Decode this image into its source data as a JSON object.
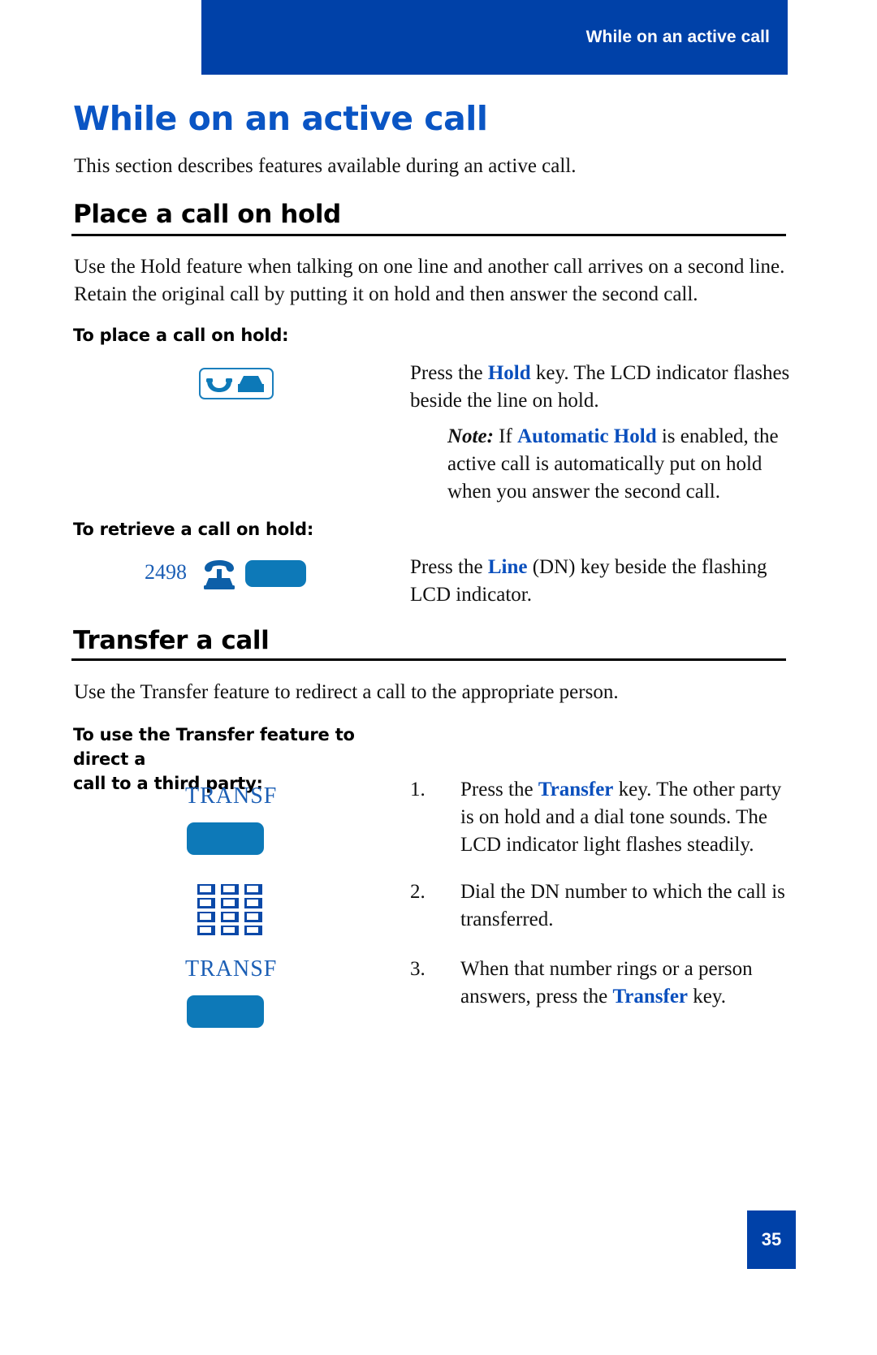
{
  "header": {
    "running_title": "While on an active call"
  },
  "page_title": "While on an active call",
  "intro": "This section describes features available during an active call.",
  "sections": [
    {
      "heading": "Place a call on hold",
      "body": "Use the Hold feature when talking on one line and another call arrives on a second line. Retain the original call by putting it on hold and then answer the second call.",
      "sub1_head": "To place a call on hold:",
      "sub1_icon": "hold-key-icon",
      "sub1_text_pre": "Press the ",
      "sub1_text_key": "Hold",
      "sub1_text_post": " key. The LCD indicator flashes beside the line on hold.",
      "note_label": "Note:",
      "note_pre": " If ",
      "note_key": "Automatic Hold",
      "note_post": " is enabled, the active call is automatically put on hold when you answer the second call.",
      "sub2_head": "To retrieve a call on hold:",
      "sub2_dn": "2498",
      "sub2_text_pre": "Press the ",
      "sub2_text_key": "Line",
      "sub2_text_post": " (DN) key beside the flashing LCD indicator."
    },
    {
      "heading": "Transfer a call",
      "body": "Use the Transfer feature to redirect a call to the appropriate person.",
      "sub1_head_line1": "To use the Transfer feature to direct a",
      "sub1_head_line2": "call to a third party:",
      "key_label_1": "TRANSF",
      "key_label_2": "TRANSF",
      "steps": [
        {
          "num": "1.",
          "pre": "Press the ",
          "key": "Transfer",
          "post": " key. The other party is on hold and a dial tone sounds. The LCD indicator light flashes steadily."
        },
        {
          "num": "2.",
          "pre": "Dial the DN number to which the call is transferred.",
          "key": "",
          "post": ""
        },
        {
          "num": "3.",
          "pre": "When that number rings or a person answers, press the ",
          "key": "Transfer",
          "post": " key."
        }
      ]
    }
  ],
  "footer": {
    "page_number": "35"
  },
  "colors": {
    "brand_blue": "#0041a8",
    "title_blue": "#0a55c4",
    "link_blue": "#0a4fbd",
    "key_blue": "#0d79b8",
    "keypad_blue": "#0b49a8",
    "serif_blue": "#1c5fb5"
  }
}
